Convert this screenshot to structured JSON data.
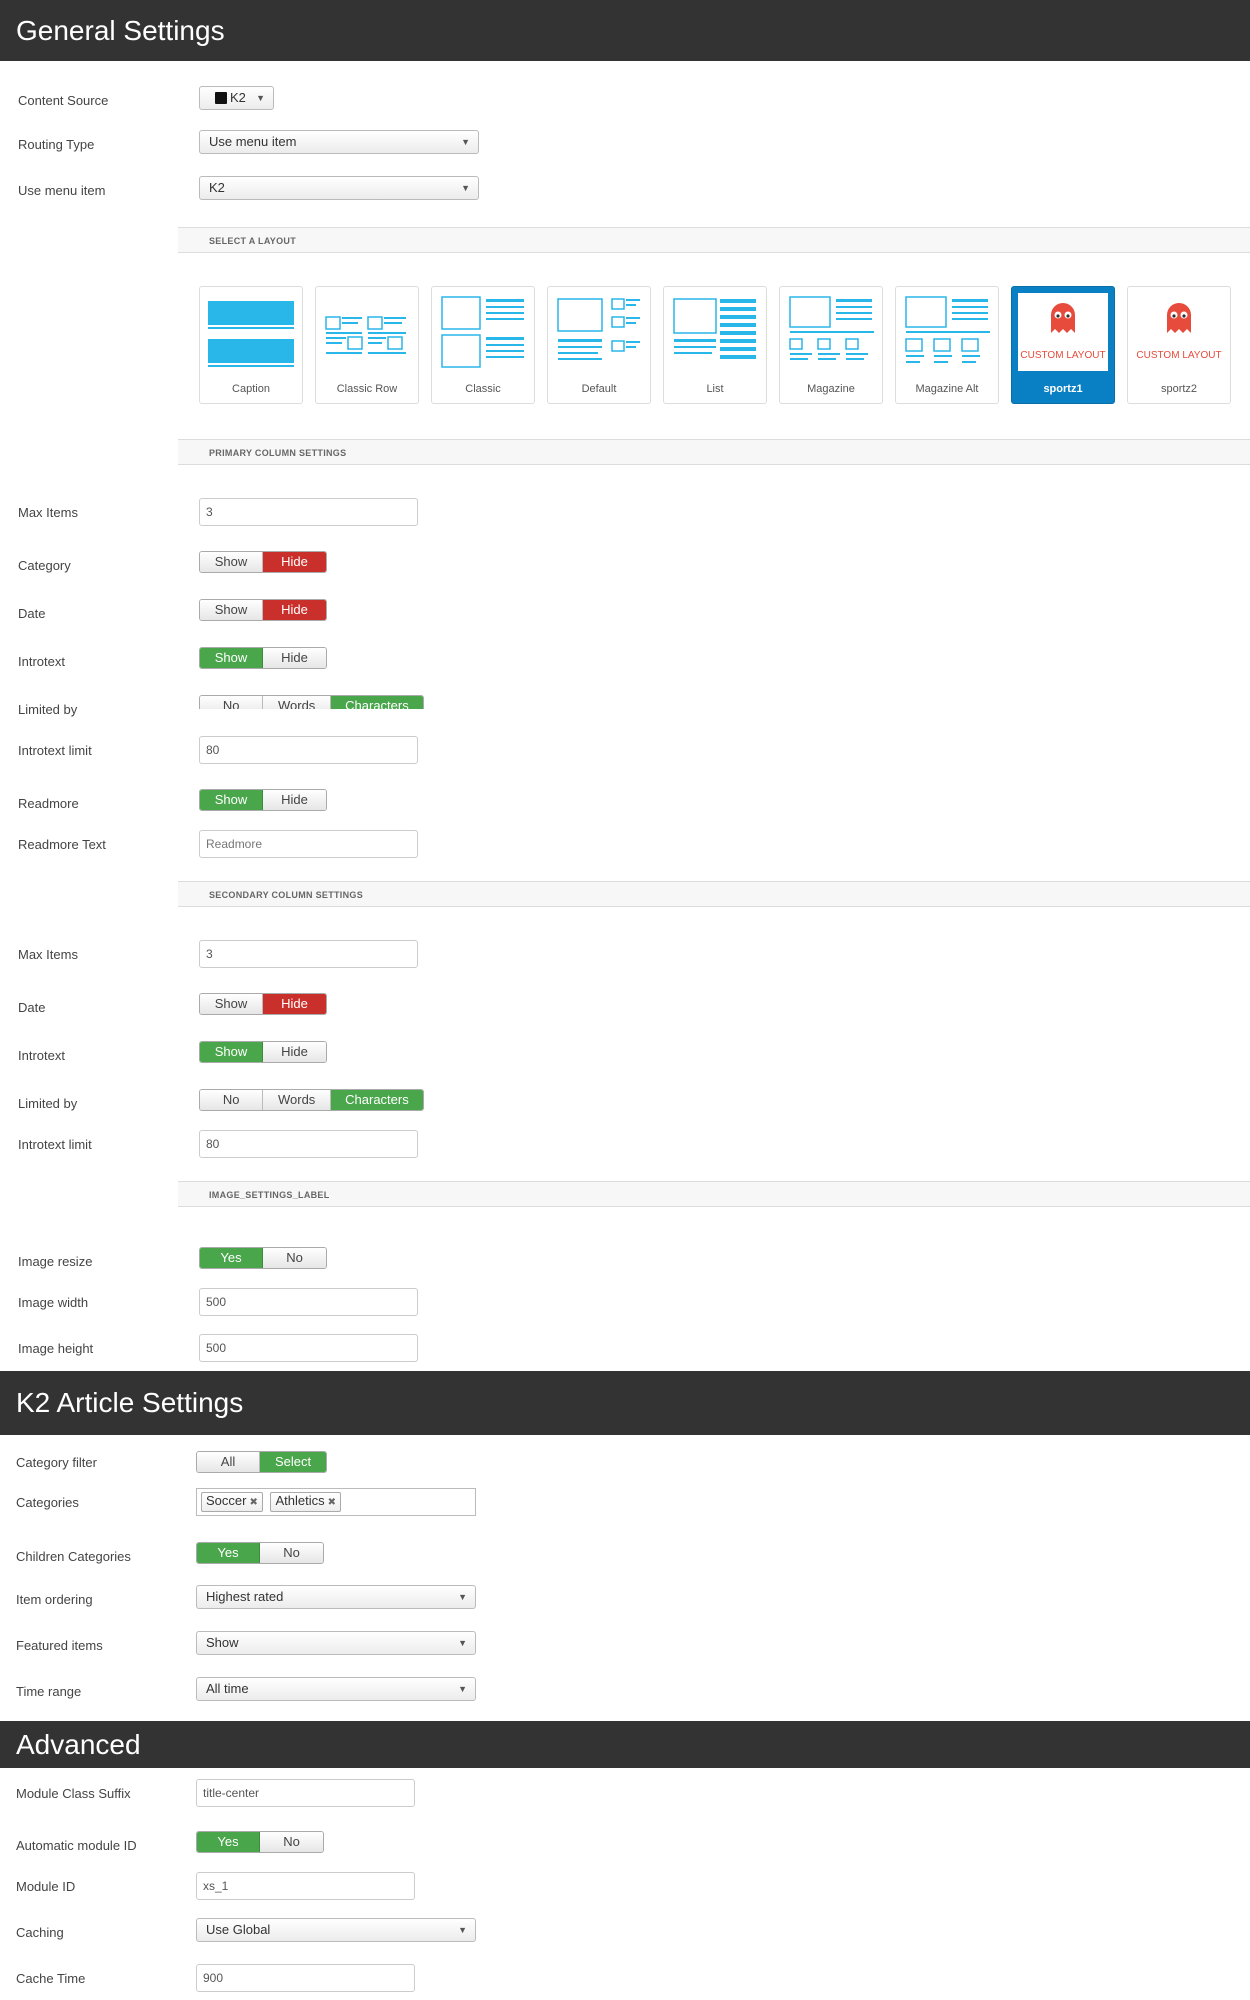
{
  "general": {
    "title": "General Settings",
    "content_source_label": "Content Source",
    "content_source_value": "K2",
    "routing_type_label": "Routing Type",
    "routing_type_value": "Use menu item",
    "use_menu_item_label": "Use menu item",
    "use_menu_item_value": "K2",
    "select_layout_label": "SELECT A LAYOUT",
    "layouts": [
      {
        "name": "Caption"
      },
      {
        "name": "Classic Row"
      },
      {
        "name": "Classic"
      },
      {
        "name": "Default"
      },
      {
        "name": "List"
      },
      {
        "name": "Magazine"
      },
      {
        "name": "Magazine Alt"
      },
      {
        "name": "sportz1",
        "badge": "CUSTOM LAYOUT"
      },
      {
        "name": "sportz2",
        "badge": "CUSTOM LAYOUT"
      }
    ],
    "selected_layout": "sportz1"
  },
  "primary": {
    "heading": "PRIMARY COLUMN SETTINGS",
    "max_items_label": "Max Items",
    "max_items_value": "3",
    "category_label": "Category",
    "date_label": "Date",
    "introtext_label": "Introtext",
    "limited_by_label": "Limited by",
    "introtext_limit_label": "Introtext limit",
    "introtext_limit_value": "80",
    "readmore_label": "Readmore",
    "readmore_text_label": "Readmore Text",
    "readmore_text_placeholder": "Readmore"
  },
  "secondary": {
    "heading": "SECONDARY COLUMN SETTINGS",
    "max_items_label": "Max Items",
    "max_items_value": "3",
    "date_label": "Date",
    "introtext_label": "Introtext",
    "limited_by_label": "Limited by",
    "introtext_limit_label": "Introtext limit",
    "introtext_limit_value": "80"
  },
  "image": {
    "heading": "IMAGE_SETTINGS_LABEL",
    "resize_label": "Image resize",
    "width_label": "Image width",
    "width_value": "500",
    "height_label": "Image height",
    "height_value": "500"
  },
  "k2": {
    "title": "K2 Article Settings",
    "category_filter_label": "Category filter",
    "categories_label": "Categories",
    "category_tags": [
      "Soccer",
      "Athletics"
    ],
    "children_label": "Children Categories",
    "ordering_label": "Item ordering",
    "ordering_value": "Highest rated",
    "featured_label": "Featured items",
    "featured_value": "Show",
    "time_range_label": "Time range",
    "time_range_value": "All time"
  },
  "advanced": {
    "title": "Advanced",
    "suffix_label": "Module Class Suffix",
    "suffix_value": "title-center",
    "auto_id_label": "Automatic module ID",
    "module_id_label": "Module ID",
    "module_id_value": "xs_1",
    "caching_label": "Caching",
    "caching_value": "Use Global",
    "cache_time_label": "Cache Time",
    "cache_time_value": "900"
  },
  "toggles": {
    "show": "Show",
    "hide": "Hide",
    "yes": "Yes",
    "no": "No",
    "no_opt": "No",
    "words": "Words",
    "characters": "Characters",
    "all": "All",
    "select": "Select"
  },
  "colors": {
    "green": "#49a64b",
    "red": "#c9302c",
    "blue": "#0a80c4",
    "cyan": "#29b6e8",
    "header": "#333333"
  }
}
